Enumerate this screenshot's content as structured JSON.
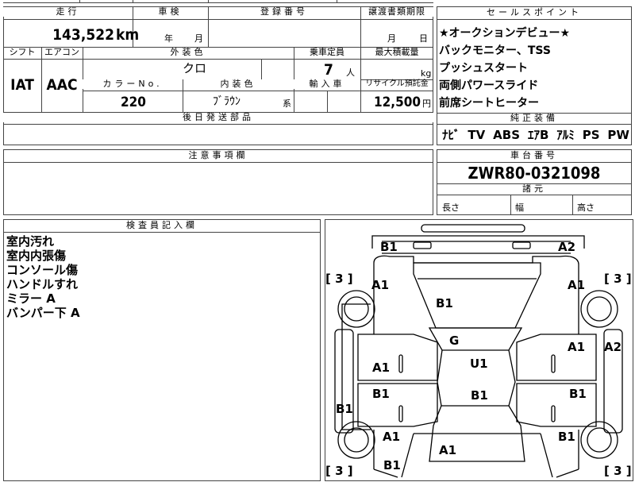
{
  "sheet": {
    "mileage_header": "走行",
    "mileage_value": "143,522",
    "mileage_unit": "km",
    "inspection_header": "車検",
    "inspection_year": "年",
    "inspection_month": "月",
    "registration_header": "登録番号",
    "transfer_header": "譲渡書類期限",
    "transfer_month": "月",
    "transfer_day": "日",
    "shift_header": "シフト",
    "shift_value": "IAT",
    "aircon_header": "エアコン",
    "aircon_value": "AAC",
    "exterior_color_header": "外装色",
    "exterior_color_value": "クロ",
    "capacity_header": "乗車定員",
    "capacity_value": "7",
    "capacity_unit": "人",
    "max_load_header": "最大積載量",
    "max_load_unit": "kg",
    "color_no_header": "カラーNo.",
    "color_no_value": "220",
    "interior_color_header": "内装色",
    "interior_color_value": "ﾌﾞﾗｳﾝ",
    "interior_color_suffix": "系",
    "import_header": "輸入車",
    "recycle_header": "リサイクル預託金",
    "recycle_value": "12,500",
    "recycle_unit": "円",
    "deferred_parts_header": "後日発送部品"
  },
  "sales_points": {
    "header": "セールスポイント",
    "items": [
      "★オークションデビュー★",
      "バックモニター、TSS",
      "プッシュスタート",
      "両側パワースライド",
      "前席シートヒーター"
    ]
  },
  "equipment": {
    "header": "純正装備",
    "items": [
      "ﾅﾋﾞ",
      "TV",
      "ABS",
      "ｴｱB",
      "ｱﾙﾐ",
      "PS",
      "PW"
    ]
  },
  "notes": {
    "header": "注意事項欄"
  },
  "chassis": {
    "header": "車台番号",
    "value": "ZWR80-0321098",
    "dims_header": "諸元",
    "length_label": "長さ",
    "width_label": "幅",
    "height_label": "高さ"
  },
  "inspector": {
    "header": "検査員記入欄",
    "comments": [
      "室内汚れ",
      "室内内張傷",
      "コンソール傷",
      "ハンドルすれ",
      "ミラー A",
      "バンパー下 A"
    ]
  },
  "diagram": {
    "marks": {
      "front_left_corner": "B1",
      "front_right_corner": "A2",
      "tire_front_left": "[ 3 ]",
      "tire_front_right": "[ 3 ]",
      "tire_rear_left": "[ 3 ]",
      "tire_rear_right": "[ 3 ]",
      "front_fender_left": "A1",
      "front_fender_right": "A1",
      "hood": "B1",
      "windshield": "G",
      "roof": "U1",
      "front_door_left": "A1",
      "front_door_right": "A1",
      "right_side_panel": "A2",
      "rear_door_left": "B1",
      "rear_door_right": "B1",
      "rear_center": "B1",
      "left_rocker": "B1",
      "rear_fender_left": "A1",
      "rear_fender_right": "B1",
      "rear_quarter_left": "A1",
      "rear_bottom_left": "B1"
    }
  }
}
